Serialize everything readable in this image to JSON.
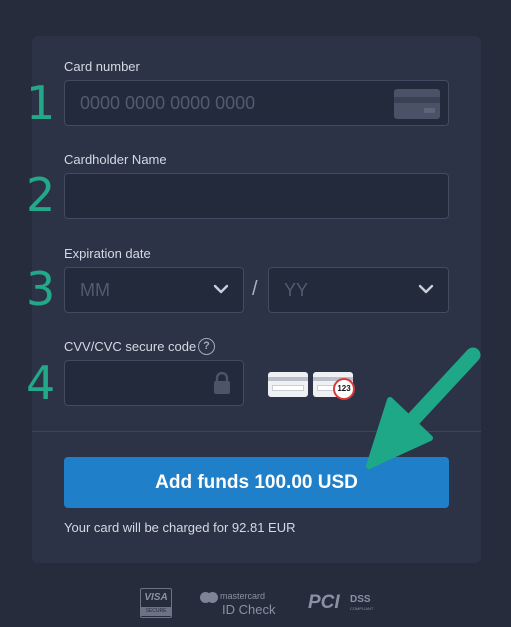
{
  "form": {
    "card_number": {
      "step": "1",
      "label": "Card number",
      "placeholder": "0000 0000 0000 0000",
      "value": "",
      "icon": "credit-card-icon"
    },
    "cardholder": {
      "step": "2",
      "label": "Cardholder Name",
      "placeholder": "",
      "value": ""
    },
    "expiration": {
      "step": "3",
      "label": "Expiration date",
      "month_placeholder": "MM",
      "year_placeholder": "YY",
      "separator": "/"
    },
    "cvv": {
      "step": "4",
      "label": "CVV/CVC secure code",
      "help": "?",
      "icon": "lock-icon",
      "example_code": "123"
    }
  },
  "submit": {
    "label": "Add funds 100.00 USD"
  },
  "charge_note": "Your card will be charged for 92.81 EUR",
  "badges": {
    "visa": {
      "line1": "VISA",
      "line2": "SECURE"
    },
    "mastercard": {
      "line1": "mastercard",
      "line2": "ID Check"
    },
    "pci": {
      "line1": "PCI",
      "line2": "DSS",
      "line3": "COMPLIANT"
    }
  },
  "colors": {
    "accent_button": "#1f7fc9",
    "step_numbers": "#23a88a",
    "arrow": "#1ea887",
    "panel": "#2c3346",
    "background": "#262c3c"
  }
}
